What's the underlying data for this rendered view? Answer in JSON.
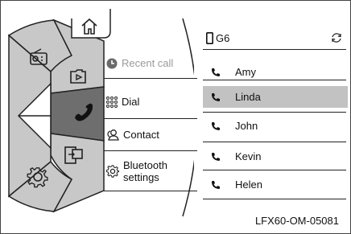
{
  "menu": {
    "items": [
      {
        "key": "recent",
        "label": "Recent call",
        "icon": "recent-clock-icon",
        "enabled": false
      },
      {
        "key": "dial",
        "label": "Dial",
        "icon": "dial-keypad-icon",
        "enabled": true
      },
      {
        "key": "contact",
        "label": "Contact",
        "icon": "contact-icon",
        "enabled": true
      },
      {
        "key": "bluetooth",
        "label_line1": "Bluetooth",
        "label_line2": "settings",
        "icon": "gear-icon",
        "enabled": true
      }
    ]
  },
  "wheel": {
    "segments": [
      {
        "name": "home",
        "icon": "home-icon"
      },
      {
        "name": "radio",
        "icon": "radio-icon"
      },
      {
        "name": "media",
        "icon": "media-play-icon"
      },
      {
        "name": "phone",
        "icon": "phone-icon",
        "active": true
      },
      {
        "name": "projection",
        "icon": "app-projection-icon"
      },
      {
        "name": "settings",
        "icon": "settings-gear-icon"
      }
    ],
    "colors": {
      "segment": "#c8c8c8",
      "active": "#6e6e6e",
      "outline": "#222222"
    }
  },
  "phone": {
    "device_name": "G6",
    "sync_icon": "refresh-icon",
    "contacts": [
      {
        "name": "Amy",
        "selected": false
      },
      {
        "name": "Linda",
        "selected": true
      },
      {
        "name": "John",
        "selected": false
      },
      {
        "name": "Kevin",
        "selected": false
      },
      {
        "name": "Helen",
        "selected": false
      }
    ]
  },
  "document_code": "LFX60-OM-05081"
}
